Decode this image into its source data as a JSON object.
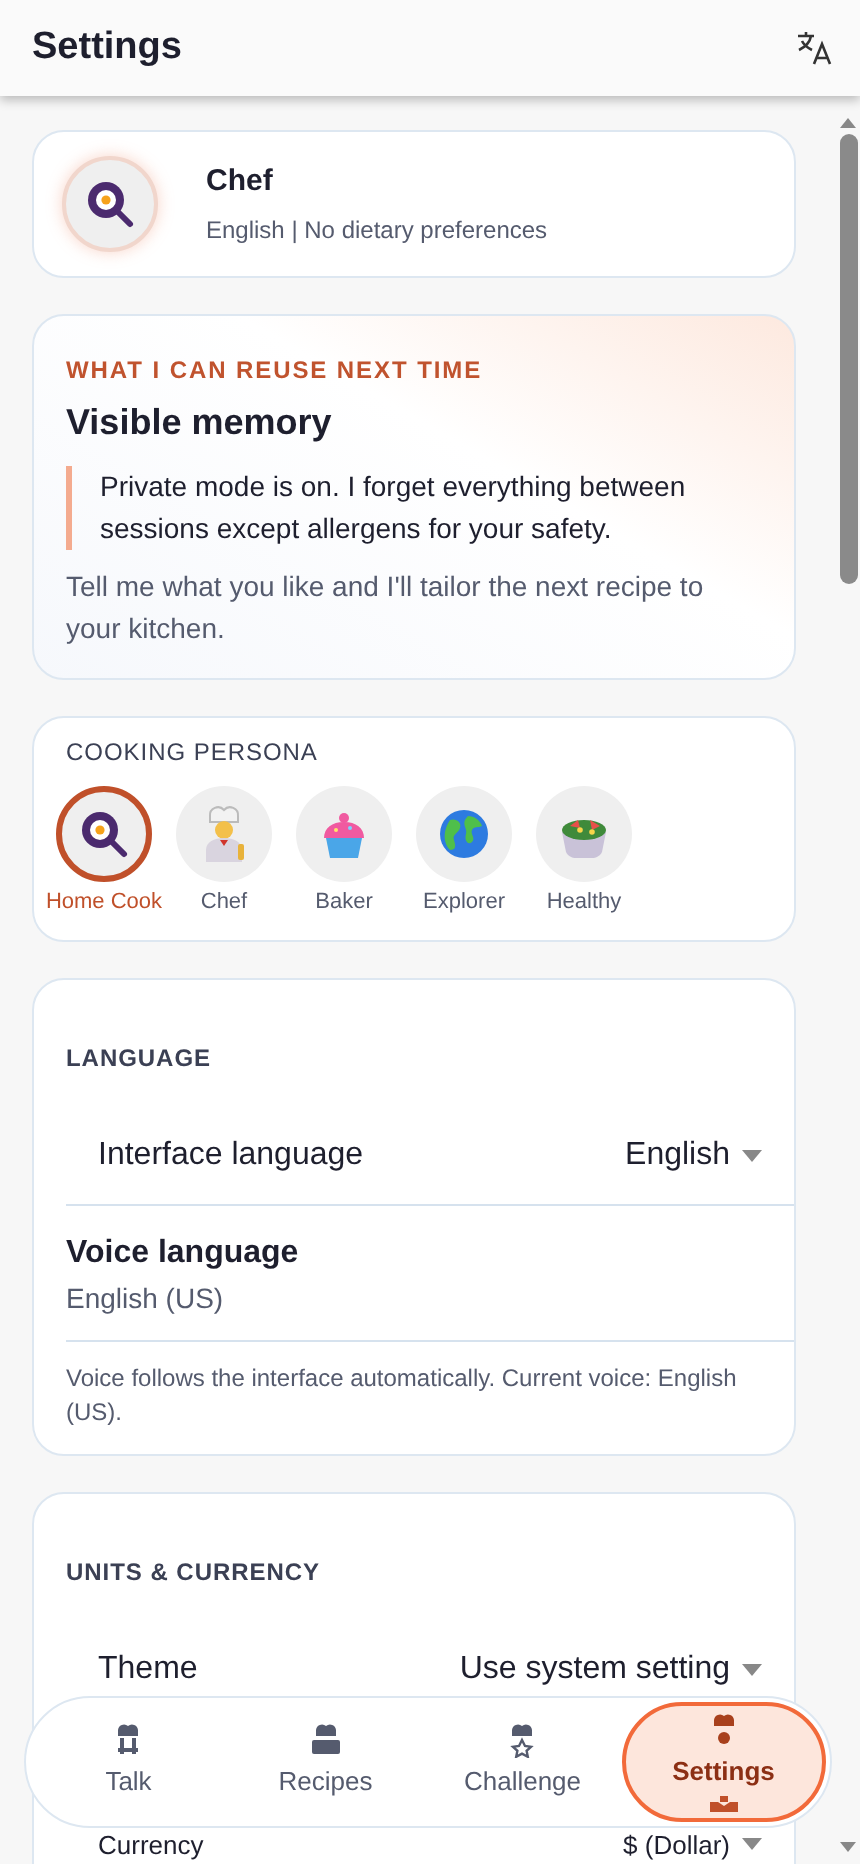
{
  "header": {
    "title": "Settings"
  },
  "profile": {
    "name": "Chef",
    "subtitle": "English | No dietary preferences"
  },
  "memory": {
    "eyebrow": "WHAT I CAN REUSE NEXT TIME",
    "title": "Visible memory",
    "notice": "Private mode is on. I forget everything between sessions except allergens for your safety.",
    "hint": "Tell me what you like and I'll tailor the next recipe to your kitchen."
  },
  "persona": {
    "label": "COOKING PERSONA",
    "options": [
      {
        "label": "Home Cook",
        "kind": "pan",
        "selected": true
      },
      {
        "label": "Chef",
        "kind": "chef",
        "selected": false
      },
      {
        "label": "Baker",
        "kind": "cupcake",
        "selected": false
      },
      {
        "label": "Explorer",
        "kind": "globe",
        "selected": false
      },
      {
        "label": "Healthy",
        "kind": "salad",
        "selected": false
      }
    ]
  },
  "language": {
    "label": "LANGUAGE",
    "rows": [
      {
        "label": "Interface language",
        "value": "English"
      }
    ],
    "voice": {
      "title": "Voice language",
      "value": "English (US)"
    },
    "note": "Voice follows the interface automatically. Current voice: English (US)."
  },
  "units": {
    "label": "UNITS & CURRENCY",
    "rows": [
      {
        "label": "Theme",
        "value": "Use system setting"
      },
      {
        "label": "Currency",
        "value": "$ (Dollar)"
      }
    ]
  },
  "nav": [
    {
      "label": "Talk",
      "kind": "talk",
      "selected": false
    },
    {
      "label": "Recipes",
      "kind": "recipes",
      "selected": false
    },
    {
      "label": "Challenge",
      "kind": "challenge",
      "selected": false
    },
    {
      "label": "Settings",
      "kind": "settings",
      "selected": true
    }
  ]
}
